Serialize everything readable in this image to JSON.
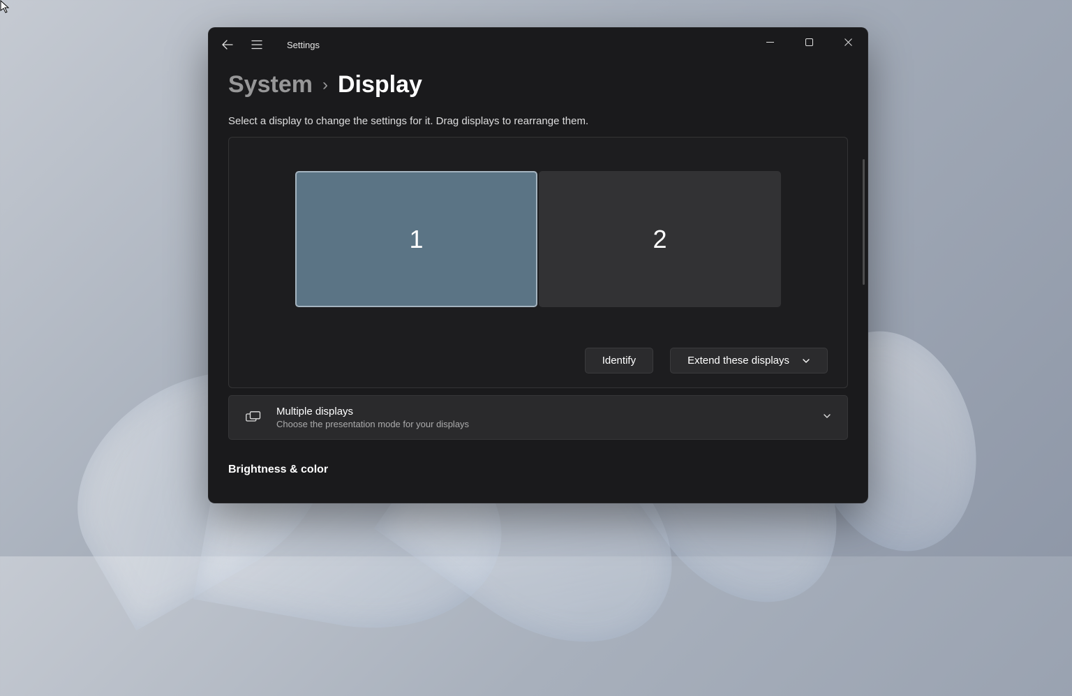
{
  "app_title": "Settings",
  "breadcrumb": {
    "parent": "System",
    "separator": "›",
    "current": "Display"
  },
  "instruction": "Select a display to change the settings for it. Drag displays to rearrange them.",
  "monitors": {
    "display1": "1",
    "display2": "2"
  },
  "actions": {
    "identify": "Identify",
    "extend": "Extend these displays"
  },
  "multiple_displays": {
    "title": "Multiple displays",
    "subtitle": "Choose the presentation mode for your displays"
  },
  "section_brightness": "Brightness & color"
}
